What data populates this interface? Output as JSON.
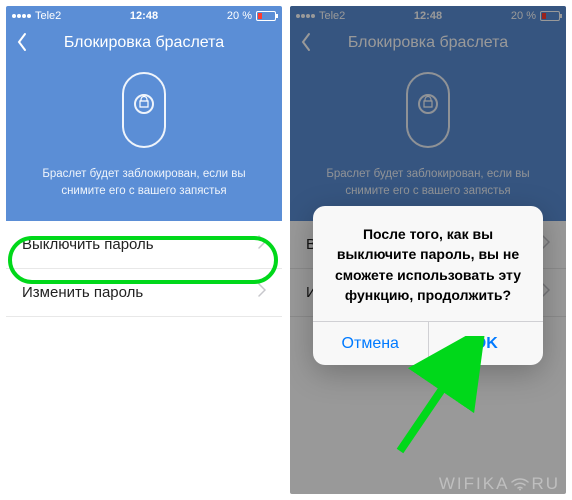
{
  "status": {
    "carrier": "Tele2",
    "time": "12:48",
    "battery": "20 %"
  },
  "header": {
    "title": "Блокировка браслета"
  },
  "hero": {
    "text": "Браслет будет заблокирован, если вы снимите его с вашего запястья"
  },
  "rows": {
    "disable": "Выключить пароль",
    "change": "Изменить пароль"
  },
  "dialog": {
    "message": "После того, как вы выключите пароль, вы не сможете использовать эту функцию, продолжить?",
    "cancel": "Отмена",
    "ok": "OK"
  },
  "watermark": {
    "left": "WIFIKA",
    "right": "RU"
  }
}
